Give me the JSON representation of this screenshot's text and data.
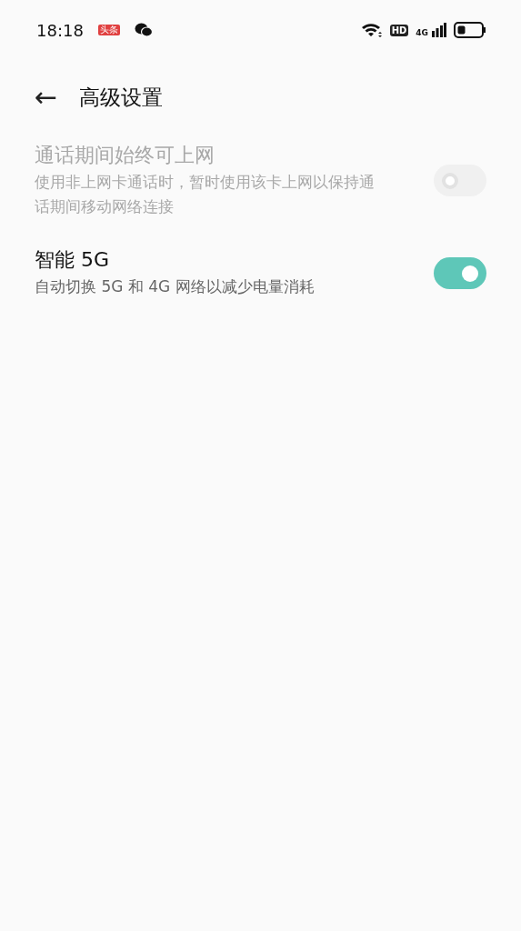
{
  "status_bar": {
    "time": "18:18",
    "notification_badge": "头条",
    "hd_label": "HD",
    "network_label": "4G"
  },
  "header": {
    "back": "←",
    "title": "高级设置"
  },
  "settings": [
    {
      "title": "通话期间始终可上网",
      "description": "使用非上网卡通话时，暂时使用该卡上网以保持通话期间移动网络连接",
      "on": false,
      "disabled": true
    },
    {
      "title": "智能 5G",
      "description": "自动切换 5G 和 4G 网络以减少电量消耗",
      "on": true,
      "disabled": false
    }
  ]
}
